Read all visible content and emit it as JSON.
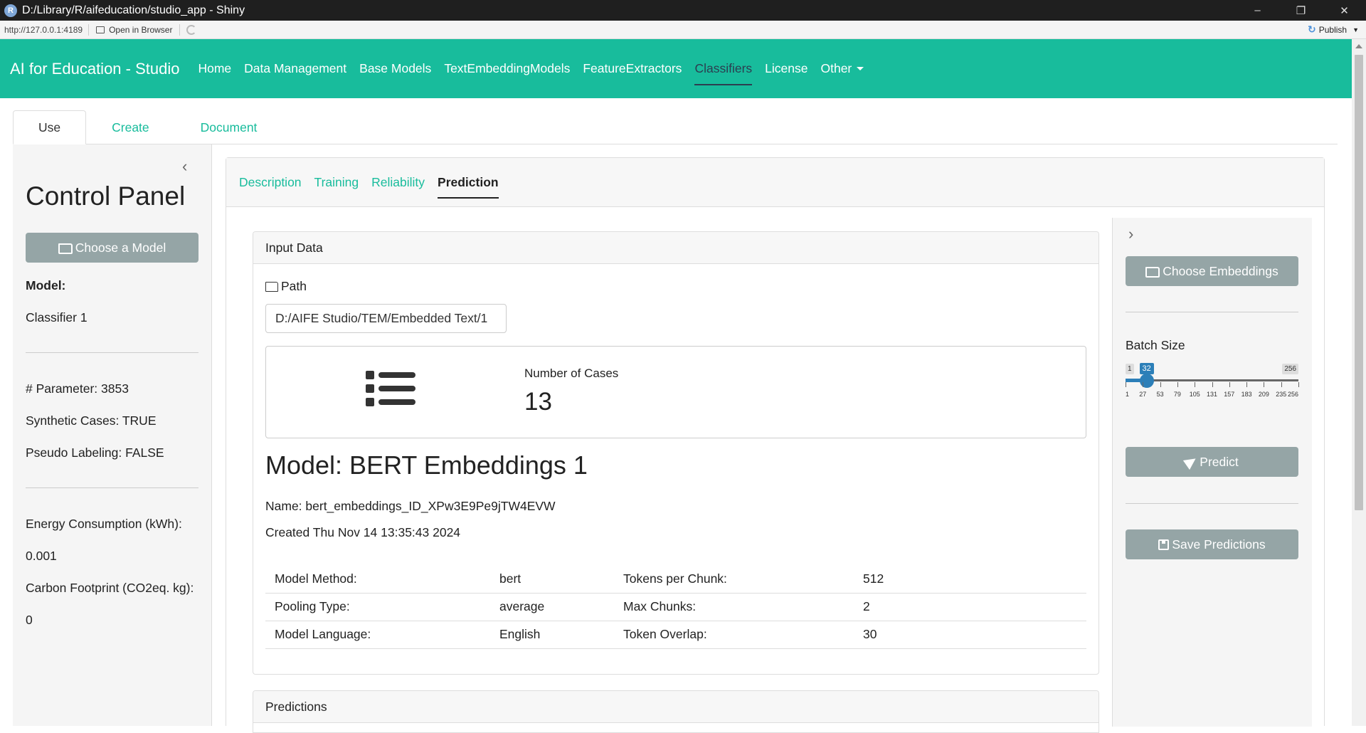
{
  "window": {
    "title": "D:/Library/R/aifeducation/studio_app - Shiny",
    "app_icon_letter": "R"
  },
  "viewer": {
    "url": "http://127.0.0.1:4189",
    "open_browser_label": "Open in Browser",
    "publish_label": "Publish"
  },
  "navbar": {
    "brand": "AI for Education - Studio",
    "items": [
      {
        "label": "Home"
      },
      {
        "label": "Data Management"
      },
      {
        "label": "Base Models"
      },
      {
        "label": "TextEmbeddingModels"
      },
      {
        "label": "FeatureExtractors"
      },
      {
        "label": "Classifiers",
        "active": true
      },
      {
        "label": "License"
      },
      {
        "label": "Other",
        "dropdown": true
      }
    ],
    "color": "#18bc9c"
  },
  "top_tabs": [
    {
      "label": "Use",
      "active": true
    },
    {
      "label": "Create"
    },
    {
      "label": "Document"
    }
  ],
  "sidebar": {
    "title": "Control Panel",
    "choose_model_label": "Choose a Model",
    "model_heading": "Model:",
    "model_name": "Classifier 1",
    "parameter": "# Parameter: 3853",
    "synthetic_cases": "Synthetic Cases: TRUE",
    "pseudo_labeling": "Pseudo Labeling: FALSE",
    "energy_label": "Energy Consumption (kWh):",
    "energy_value": "0.001",
    "carbon_label": "Carbon Footprint (CO2eq. kg):",
    "carbon_value": "0"
  },
  "sub_tabs": [
    {
      "label": "Description"
    },
    {
      "label": "Training"
    },
    {
      "label": "Reliability"
    },
    {
      "label": "Prediction",
      "active": true
    }
  ],
  "input_data": {
    "header": "Input Data",
    "path_label": "Path",
    "path_value": "D:/AIFE Studio/TEM/Embedded Text/1",
    "cases_label": "Number of Cases",
    "cases_value": "13",
    "model_title": "Model: BERT Embeddings 1",
    "name_line": "Name: bert_embeddings_ID_XPw3E9Pe9jTW4EVW",
    "created_line": "Created Thu Nov 14 13:35:43 2024",
    "table": [
      [
        "Model Method:",
        "bert",
        "Tokens per Chunk:",
        "512"
      ],
      [
        "Pooling Type:",
        "average",
        "Max Chunks:",
        "2"
      ],
      [
        "Model Language:",
        "English",
        "Token Overlap:",
        "30"
      ]
    ]
  },
  "predictions": {
    "header": "Predictions"
  },
  "right_panel": {
    "choose_embeddings_label": "Choose Embeddings",
    "batch_size_label": "Batch Size",
    "batch_size": {
      "min": 1,
      "max": 256,
      "value": 32,
      "min_label": "1",
      "max_label": "256",
      "value_label": "32",
      "ticks": [
        "1",
        "27",
        "53",
        "79",
        "105",
        "131",
        "157",
        "183",
        "209",
        "235",
        "256"
      ]
    },
    "predict_label": "Predict",
    "save_label": "Save Predictions"
  }
}
